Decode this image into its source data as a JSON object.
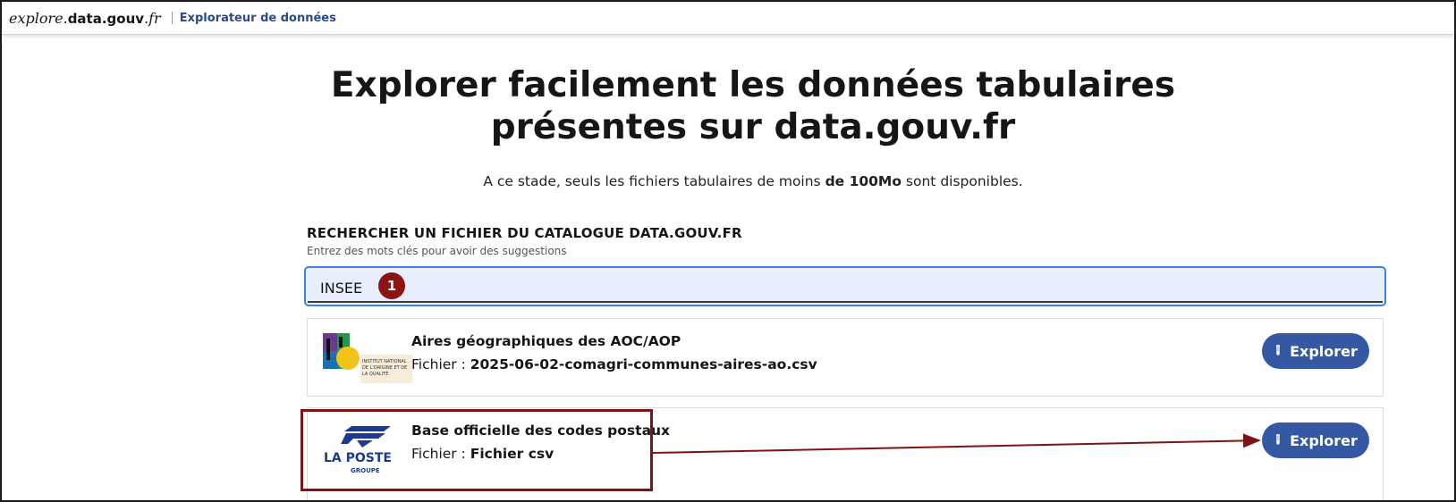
{
  "header": {
    "brand_prefix": "explore.",
    "brand_bold": "data.gouv",
    "brand_suffix": ".fr",
    "subtitle": "Explorateur de données"
  },
  "hero": {
    "title_line1": "Explorer facilement les données tabulaires",
    "title_line2": "présentes sur data.gouv.fr",
    "sub_before": "A ce stade, seuls les fichiers tabulaires de moins ",
    "sub_bold": "de 100Mo",
    "sub_after": " sont disponibles."
  },
  "search": {
    "label": "RECHERCHER UN FICHIER DU CATALOGUE DATA.GOUV.FR",
    "hint": "Entrez des mots clés pour avoir des suggestions",
    "value": "INSEE",
    "badge": "1"
  },
  "results": [
    {
      "title": "Aires géographiques des AOC/AOP",
      "file_prefix": "Fichier : ",
      "file_name": "2025-06-02-comagri-communes-aires-ao.csv",
      "button": "Explorer",
      "logo_text": "INSTITUT NATIONAL DE L'ORIGINE ET DE LA QUALITÉ"
    },
    {
      "title": "Base officielle des codes postaux",
      "file_prefix": "Fichier : ",
      "file_name": "Fichier csv",
      "button": "Explorer",
      "logo_text": "LA POSTE",
      "logo_subtext": "GROUPE"
    }
  ],
  "colors": {
    "accent": "#3458a4",
    "annotation": "#7d1414",
    "search_bg": "#e8eefb"
  }
}
